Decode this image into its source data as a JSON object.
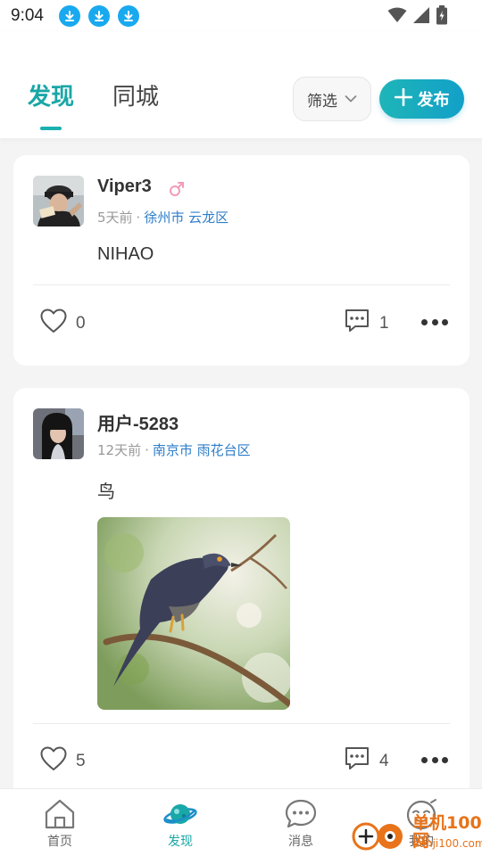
{
  "status_bar": {
    "time": "9:04",
    "download_badges": [
      "download-icon",
      "download-icon",
      "download-icon"
    ]
  },
  "header": {
    "tabs": [
      {
        "label": "发现",
        "active": true
      },
      {
        "label": "同城",
        "active": false
      }
    ],
    "filter_label": "筛选",
    "publish_label": "发布",
    "accent_color": "#1aa6a6"
  },
  "posts": [
    {
      "username": "Viper3",
      "gender": "male",
      "time_ago": "5天前",
      "separator": "·",
      "location": "徐州市 云龙区",
      "text": "NIHAO",
      "likes": "0",
      "comments": "1"
    },
    {
      "username": "用户-5283",
      "time_ago": "12天前",
      "separator": "·",
      "location": "南京市 雨花台区",
      "text": "鸟",
      "likes": "5",
      "comments": "4"
    }
  ],
  "bottom_nav": [
    {
      "label": "首页",
      "icon": "home-icon",
      "active": false
    },
    {
      "label": "发现",
      "icon": "planet-icon",
      "active": true
    },
    {
      "label": "消息",
      "icon": "message-icon",
      "active": false
    },
    {
      "label": "我的",
      "icon": "profile-face-icon",
      "active": false
    }
  ],
  "watermark": {
    "text": "单机100网",
    "sub": "danji100.com"
  }
}
